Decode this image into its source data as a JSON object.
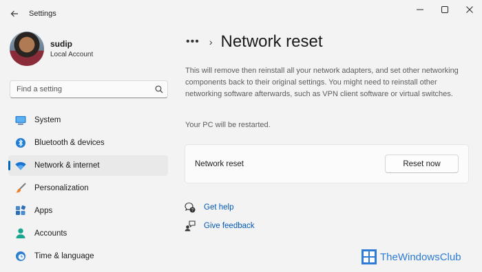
{
  "window": {
    "title": "Settings",
    "back_icon": "back-arrow-icon",
    "controls": [
      "minimize-icon",
      "maximize-icon",
      "close-icon"
    ]
  },
  "profile": {
    "name": "sudip",
    "account_type": "Local Account"
  },
  "search": {
    "placeholder": "Find a setting",
    "icon": "search-icon"
  },
  "sidebar": {
    "items": [
      {
        "label": "System",
        "icon": "system-icon",
        "active": false
      },
      {
        "label": "Bluetooth & devices",
        "icon": "bluetooth-icon",
        "active": false
      },
      {
        "label": "Network & internet",
        "icon": "wifi-icon",
        "active": true
      },
      {
        "label": "Personalization",
        "icon": "brush-icon",
        "active": false
      },
      {
        "label": "Apps",
        "icon": "apps-icon",
        "active": false
      },
      {
        "label": "Accounts",
        "icon": "accounts-icon",
        "active": false
      },
      {
        "label": "Time & language",
        "icon": "globe-clock-icon",
        "active": false
      }
    ]
  },
  "main": {
    "breadcrumb_more": "•••",
    "breadcrumb_sep": "›",
    "title": "Network reset",
    "description": "This will remove then reinstall all your network adapters, and set other networking components back to their original settings. You might need to reinstall other networking software afterwards, such as VPN client software or virtual switches.",
    "restart_note": "Your PC will be restarted.",
    "card": {
      "label": "Network reset",
      "button": "Reset now"
    },
    "links": [
      {
        "label": "Get help",
        "icon": "help-icon"
      },
      {
        "label": "Give feedback",
        "icon": "feedback-icon"
      }
    ]
  },
  "watermark": {
    "text": "TheWindowsClub"
  },
  "colors": {
    "accent": "#0067c0",
    "link": "#0057b7",
    "background": "#f3f3f3"
  }
}
